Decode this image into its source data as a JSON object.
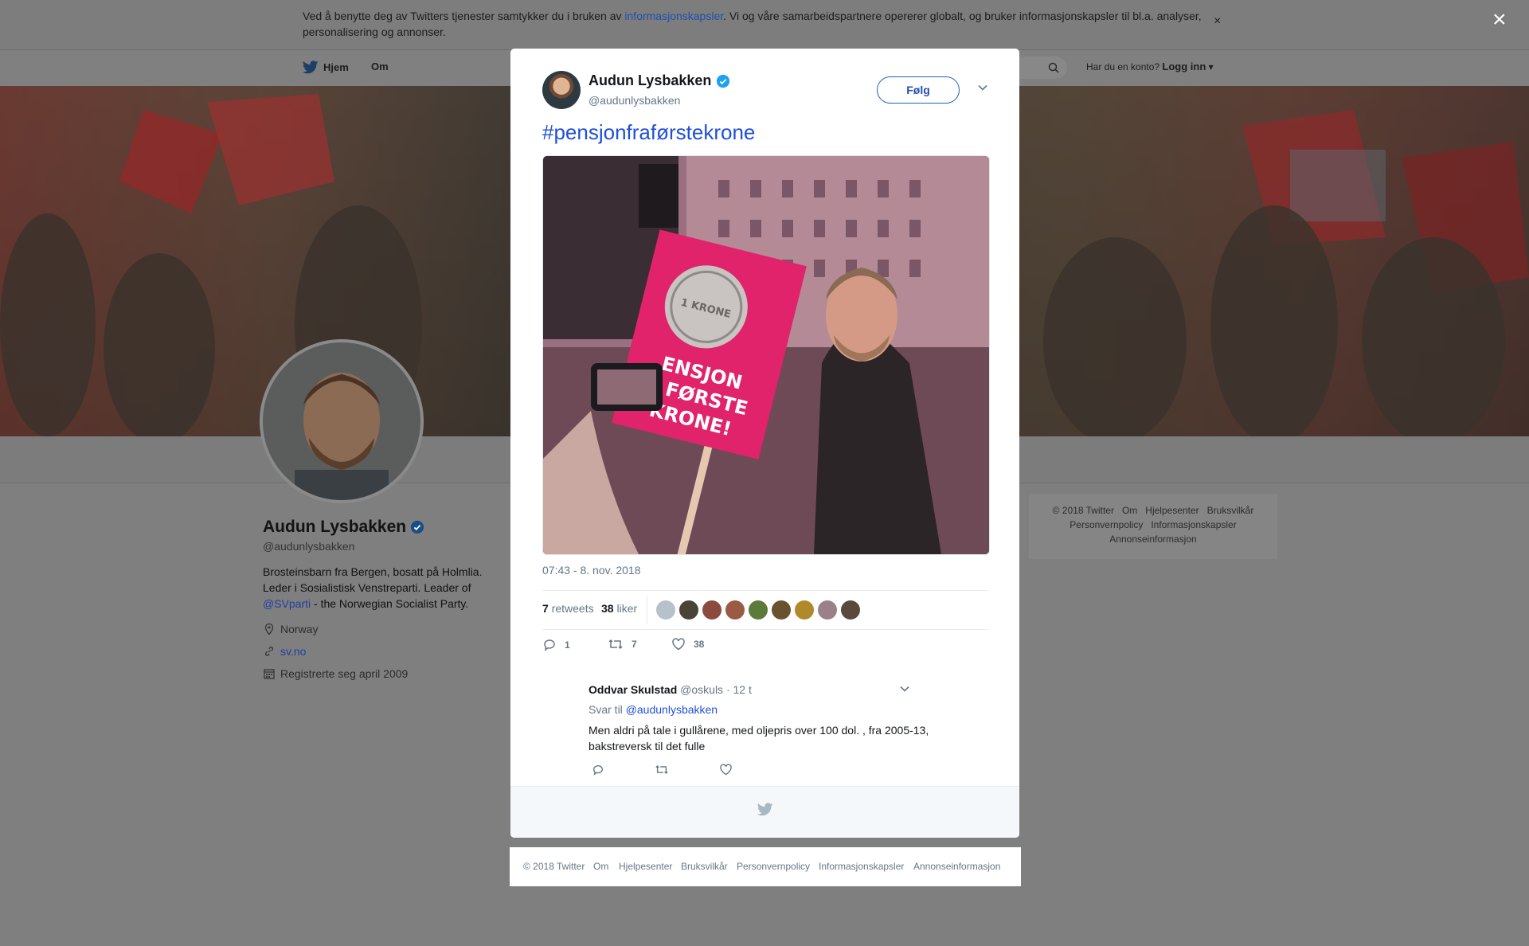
{
  "cookie_banner": {
    "text_before": "Ved å benytte deg av Twitters tjenester samtykker du i bruken av ",
    "link": "informasjonskapsler",
    "text_after": ". Vi og våre samarbeidspartnere opererer globalt, og bruker informasjonskapsler til bl.a. analyser, personalisering og annonser.",
    "close": "×"
  },
  "nav": {
    "home": "Hjem",
    "about": "Om",
    "account_prompt": "Har du en konto?",
    "login": "Logg inn"
  },
  "profile": {
    "name": "Audun Lysbakken",
    "handle": "@audunlysbakken",
    "bio_1": "Brosteinsbarn fra Bergen, bosatt på Holmlia. Leder i Sosialistisk Venstreparti. Leader of ",
    "bio_mention": "@SVparti",
    "bio_2": " - the Norwegian Socialist Party.",
    "location": "Norway",
    "url": "sv.no",
    "joined": "Registrerte seg april 2009"
  },
  "side_footer": {
    "items": [
      "© 2018 Twitter",
      "Om",
      "Hjelpesenter",
      "Bruksvilkår",
      "Personvernpolicy",
      "Informasjonskapsler",
      "Annonseinformasjon"
    ]
  },
  "overlay_close": "×",
  "tweet": {
    "author_name": "Audun Lysbakken",
    "author_handle": "@audunlysbakken",
    "follow_label": "Følg",
    "text": "#pensjonfraførstekrone",
    "sign_text": [
      "ENSJON",
      "A FØRSTE",
      "KRONE!"
    ],
    "coin_text": "1 KRONE",
    "timestamp": "07:43 - 8. nov. 2018",
    "retweets_count": "7",
    "retweets_label": "retweets",
    "likes_count": "38",
    "likes_label": "liker",
    "reply_count": "1",
    "retweet_count": "7",
    "like_count": "38"
  },
  "reply": {
    "name": "Oddvar Skulstad",
    "handle": "@oskuls",
    "time": "· 12 t",
    "reply_to_label": "Svar til",
    "reply_to_handle": "@audunlysbakken",
    "text": "Men aldri på tale i gullårene, med oljepris over 100 dol. , fra 2005-13, bakstreversk til det fulle"
  },
  "footer": {
    "items": [
      "© 2018 Twitter",
      "Om",
      "Hjelpesenter",
      "Bruksvilkår",
      "Personvernpolicy",
      "Informasjonskapsler",
      "Annonseinformasjon"
    ]
  },
  "colors": {
    "link_blue": "#1f4fd9",
    "verified": "#1da1f2",
    "overlay": "#7f7f7f",
    "modal_bg": "#ffffff"
  }
}
